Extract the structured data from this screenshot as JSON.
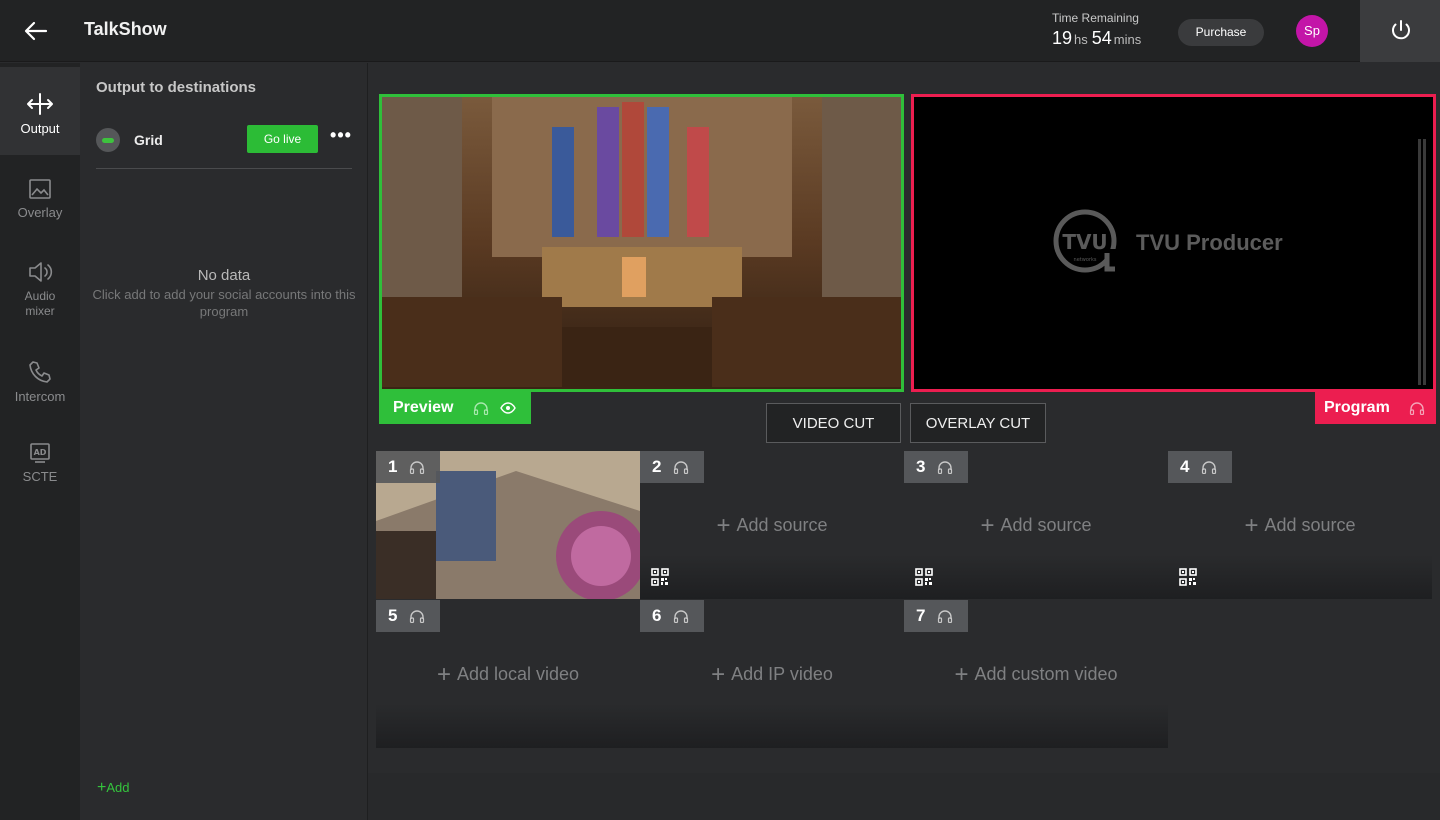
{
  "header": {
    "title": "TalkShow",
    "time_label": "Time Remaining",
    "hours": "19",
    "hours_unit": "hs",
    "minutes": "54",
    "minutes_unit": "mins",
    "purchase_label": "Purchase",
    "avatar_initials": "Sp"
  },
  "nav": {
    "items": [
      {
        "label": "Output",
        "icon": "output-icon"
      },
      {
        "label": "Overlay",
        "icon": "image-icon"
      },
      {
        "label": "Audio mixer",
        "icon": "speaker-icon"
      },
      {
        "label": "Intercom",
        "icon": "phone-icon"
      },
      {
        "label": "SCTE",
        "icon": "ad-icon"
      }
    ]
  },
  "destinations": {
    "title": "Output to destinations",
    "row_name": "Grid",
    "go_live_label": "Go live",
    "more_label": "•••",
    "no_data_title": "No data",
    "no_data_hint": "Click add to add your social accounts into this program",
    "add_label": "Add"
  },
  "monitors": {
    "preview_label": "Preview",
    "program_label": "Program",
    "program_logo_text": "TVU Producer",
    "program_logo_mark": "TVU",
    "program_logo_small": "networks"
  },
  "cuts": {
    "video_cut": "VIDEO CUT",
    "overlay_cut": "OVERLAY CUT"
  },
  "sources": [
    {
      "num": "1",
      "add": ""
    },
    {
      "num": "2",
      "add": "Add source"
    },
    {
      "num": "3",
      "add": "Add source"
    },
    {
      "num": "4",
      "add": "Add source"
    },
    {
      "num": "5",
      "add": "Add local video"
    },
    {
      "num": "6",
      "add": "Add IP video"
    },
    {
      "num": "7",
      "add": "Add custom video"
    }
  ],
  "colors": {
    "preview_green": "#2fbf3a",
    "program_red": "#ec1e50",
    "avatar": "#c315a8"
  }
}
